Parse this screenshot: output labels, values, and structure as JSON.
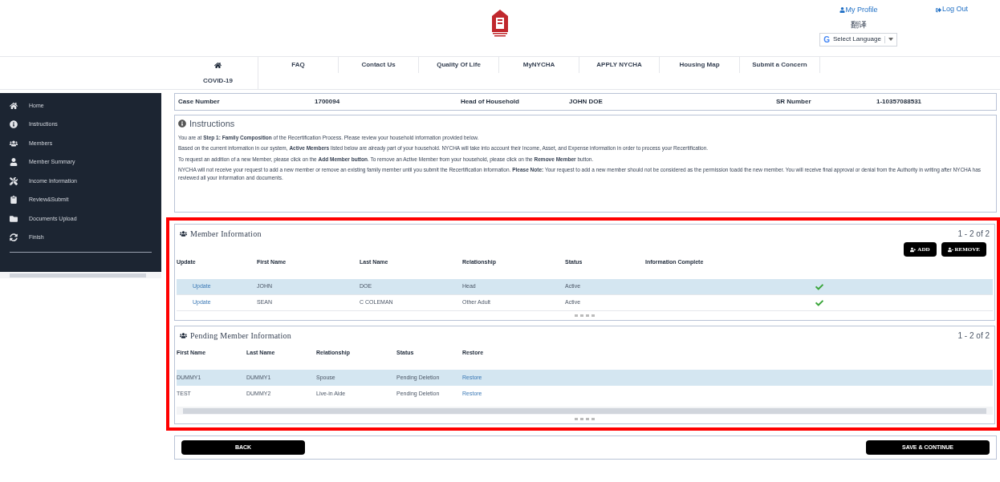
{
  "header": {
    "profile": "My Profile",
    "logout": "Log Out",
    "translate": "翻译",
    "language_badge": "G",
    "language": "Select Language"
  },
  "nav": [
    {
      "kind": "icon"
    },
    {
      "kind": "text",
      "label": "FAQ"
    },
    {
      "kind": "text",
      "label": "Contact Us"
    },
    {
      "kind": "text",
      "label": "Quality Of Life"
    },
    {
      "kind": "text",
      "label": "MyNYCHA"
    },
    {
      "kind": "text",
      "label": "APPLY NYCHA"
    },
    {
      "kind": "text",
      "label": "Housing Map"
    },
    {
      "kind": "text",
      "label": "Submit a Concern"
    },
    {
      "kind": "text",
      "label": "COVID-19"
    }
  ],
  "sidebar": {
    "items": [
      {
        "label": "Home"
      },
      {
        "label": "Instructions"
      },
      {
        "label": "Members"
      },
      {
        "label": "Member Summary"
      },
      {
        "label": "Income Information"
      },
      {
        "label": "Review&Submit"
      },
      {
        "label": "Documents Upload"
      },
      {
        "label": "Finish"
      }
    ]
  },
  "case": {
    "case_label": "Case Number",
    "case_value": "1700094",
    "head_label": "Head of Household",
    "head_value": "JOHN DOE",
    "sr_label": "SR Number",
    "sr_value": "1-10357088531"
  },
  "instructions": {
    "title": "Instructions",
    "paragraphs": [
      "You are at **Step 1: Family Composition** of the Recertification Process. Please review your household information provided below.",
      "Based on the current information in our system, **Active Members** listed below are already part of your household. NYCHA will take into account their Income, Asset, and Expense information in order to process your Recertification.",
      "To request an addition of a new Member, please click on the **Add Member button**. To remove an Active Member from your household, please click on the **Remove Member** button.",
      "NYCHA will not receive your request to add a new member or remove an existing family member until you submit the Recertification information. **Please Note:** Your request to add a new member should not be considered as the permission toadd the new member. You will receive final approval or denial from the Authority in writing after NYCHA has reviewed all your information and documents."
    ]
  },
  "members": {
    "title": "Member Information",
    "count": "1 - 2 of 2",
    "add": "ADD",
    "remove": "REMOVE",
    "columns": [
      "Update",
      "First Name",
      "Last Name",
      "Relationship",
      "Status",
      "Information Complete"
    ],
    "rows": [
      {
        "selected": true,
        "update": "Update",
        "first": "JOHN",
        "last": "DOE",
        "relationship": "Head",
        "status": "Active",
        "complete": true
      },
      {
        "selected": false,
        "update": "Update",
        "first": "SEAN",
        "last": "C COLEMAN",
        "relationship": "Other Adult",
        "status": "Active",
        "complete": true
      }
    ]
  },
  "pending": {
    "title": "Pending Member Information",
    "count": "1 - 2 of 2",
    "columns": [
      "First Name",
      "Last Name",
      "Relationship",
      "Status",
      "Restore"
    ],
    "rows": [
      {
        "selected": true,
        "first": "DUMMY1",
        "last": "DUMMY1",
        "relationship": "Spouse",
        "status": "Pending Deletion",
        "restore": "Restore"
      },
      {
        "selected": false,
        "first": "TEST",
        "last": "DUMMY2",
        "relationship": "Live-in Aide",
        "status": "Pending Deletion",
        "restore": "Restore"
      }
    ]
  },
  "footer": {
    "back": "BACK",
    "save": "SAVE & CONTINUE"
  }
}
